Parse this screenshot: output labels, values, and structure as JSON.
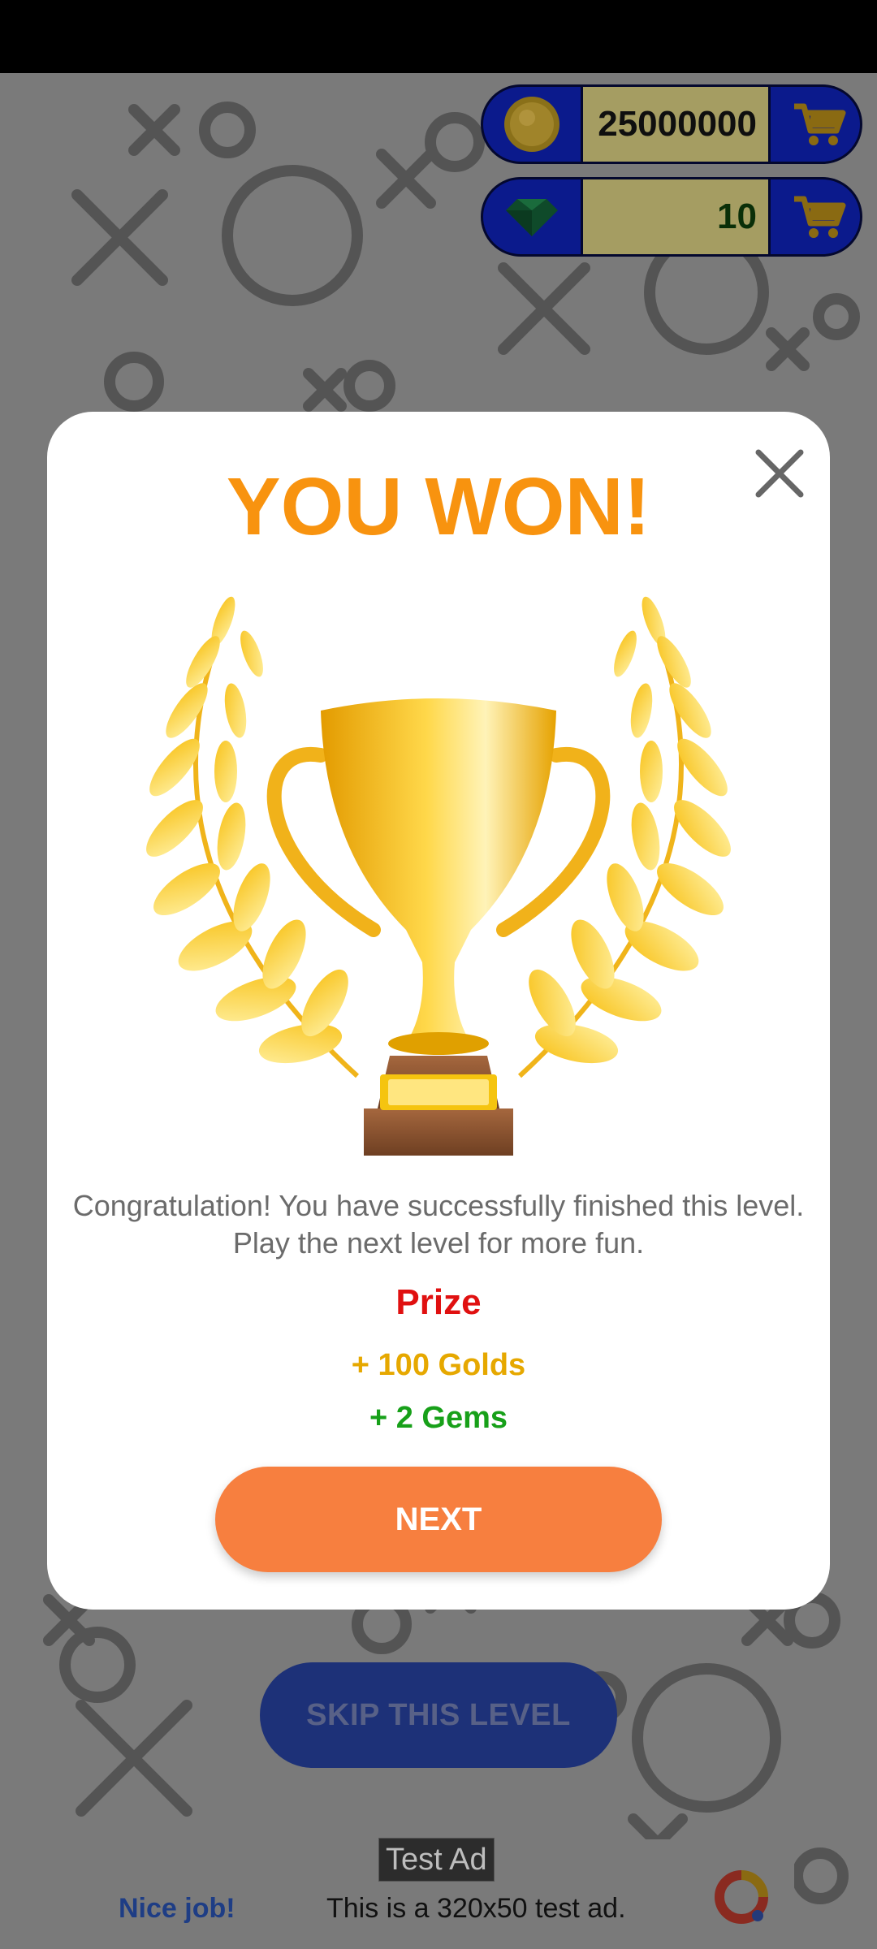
{
  "currency": {
    "coins": {
      "value": "25000000",
      "icon": "gold-coin-icon"
    },
    "gems": {
      "value": "10",
      "icon": "green-gem-icon"
    },
    "cart_icon": "shopping-cart-icon"
  },
  "background": {
    "skip_button_label": "SKIP THIS LEVEL"
  },
  "modal": {
    "title": "YOU WON!",
    "message": "Congratulation! You have successfully finished this level. Play the next level for more fun.",
    "prize_label": "Prize",
    "prize_gold": "+ 100 Golds",
    "prize_gems": "+ 2 Gems",
    "next_button_label": "NEXT",
    "title_color": "#f8930f"
  },
  "ad": {
    "tag": "Test Ad",
    "left_text": "Nice job!",
    "body_text": "This is a 320x50 test ad."
  }
}
